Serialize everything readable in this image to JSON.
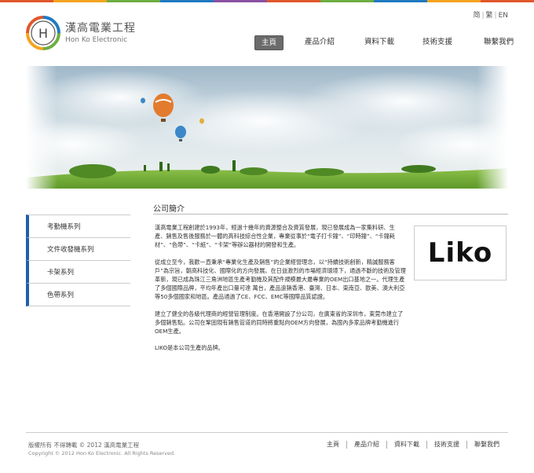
{
  "colors": {
    "topbar": [
      "#e0572b",
      "#f4a31f",
      "#6cae3f",
      "#1f7ac2",
      "#8a4fa3",
      "#e0572b",
      "#6cae3f",
      "#1f7ac2",
      "#f4a31f",
      "#e0572b"
    ],
    "accent": "#1f5fa8",
    "nav_active_bg": "#6b6b6b"
  },
  "lang": {
    "items": [
      "简",
      "繁",
      "EN"
    ]
  },
  "logo": {
    "mark": "H",
    "name_cn": "漢高電業工程",
    "name_en": "Hon Ko Electronic"
  },
  "nav": {
    "items": [
      "主頁",
      "產品介紹",
      "資料下載",
      "技術支援",
      "聯繫我們"
    ],
    "active": 0
  },
  "sidebar": {
    "items": [
      "考勤機系列",
      "文件收發機系列",
      "卡架系列",
      "色帶系列"
    ]
  },
  "section": {
    "title": "公司簡介"
  },
  "content": {
    "paragraphs": [
      "漢高電業工程創建於1993年，經過十幾年的資源整合及資質發展，現已發展成為一家集料研、生產、銷售及售後服務於一體的高科技綜合性企業，專業從事於“電子打卡鐘”、“印時鐘”、“卡鐘耗材”、“色帶”、“卡紙”、“卡架”等辦公器材的開發和生產。",
      "從成立至今，我歡一直秉承“專業化生產及銷售”的企業經營理念，以“持續技術創新，精誠服務客戶”為宗旨，朝高科技化、國際化的方向發展。在日益激烈的市場經濟環境下，通過不斷的技術及管理革新，現已成為珠江三角洲地區生產考勤機及其配件規模最大最專業的OEM出口基地之一。代理生產了多個國際品牌，平均年產出口量可達 萬台，產品遠銷香港、臺灣、日本、東南亞、歐美、澳大利亞等50多個國家和地區。產品通過了CE、FCC、EMC等國際品質認證。",
      "建立了健全的各級代理商的經營管理制度。在香港開設了分公司，在廣東省的深圳市，東莞市建立了多個銷售點。公司在鞏固現有銷售管道的同時將重點向OEM方向發展，為國內多家品牌考勤機進行OEM生產。",
      "LIKO是本公司生產的品牌。"
    ]
  },
  "brand": {
    "logo_text": "Liko"
  },
  "footer": {
    "copyright_cn": "版權所有 不得轉載 © 2012 漢高電業工程",
    "copyright_en": "Copyright © 2012 Hon Ko Electronic. All Rights Reserved.",
    "nav": [
      "主頁",
      "產品介紹",
      "資料下載",
      "技術支援",
      "聯繫我們"
    ]
  }
}
